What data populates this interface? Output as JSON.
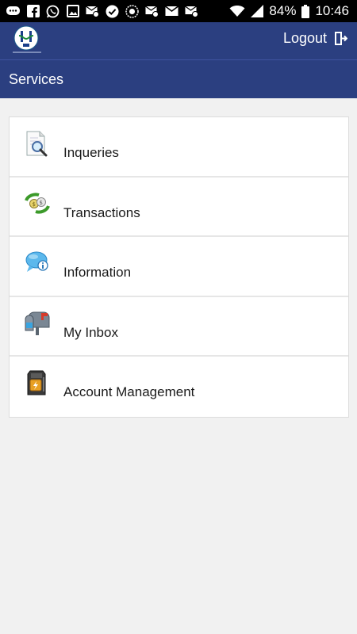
{
  "status_bar": {
    "battery": "84%",
    "time": "10:46"
  },
  "header": {
    "logout_label": "Logout"
  },
  "title": "Services",
  "menu": [
    {
      "label": "Inqueries",
      "icon": "magnifier-document-icon"
    },
    {
      "label": "Transactions",
      "icon": "money-exchange-icon"
    },
    {
      "label": "Information",
      "icon": "info-bubble-icon"
    },
    {
      "label": "My Inbox",
      "icon": "mailbox-icon"
    },
    {
      "label": "Account Management",
      "icon": "atm-machine-icon"
    }
  ],
  "colors": {
    "header": "#2b3f80",
    "background": "#f1f1f1"
  }
}
